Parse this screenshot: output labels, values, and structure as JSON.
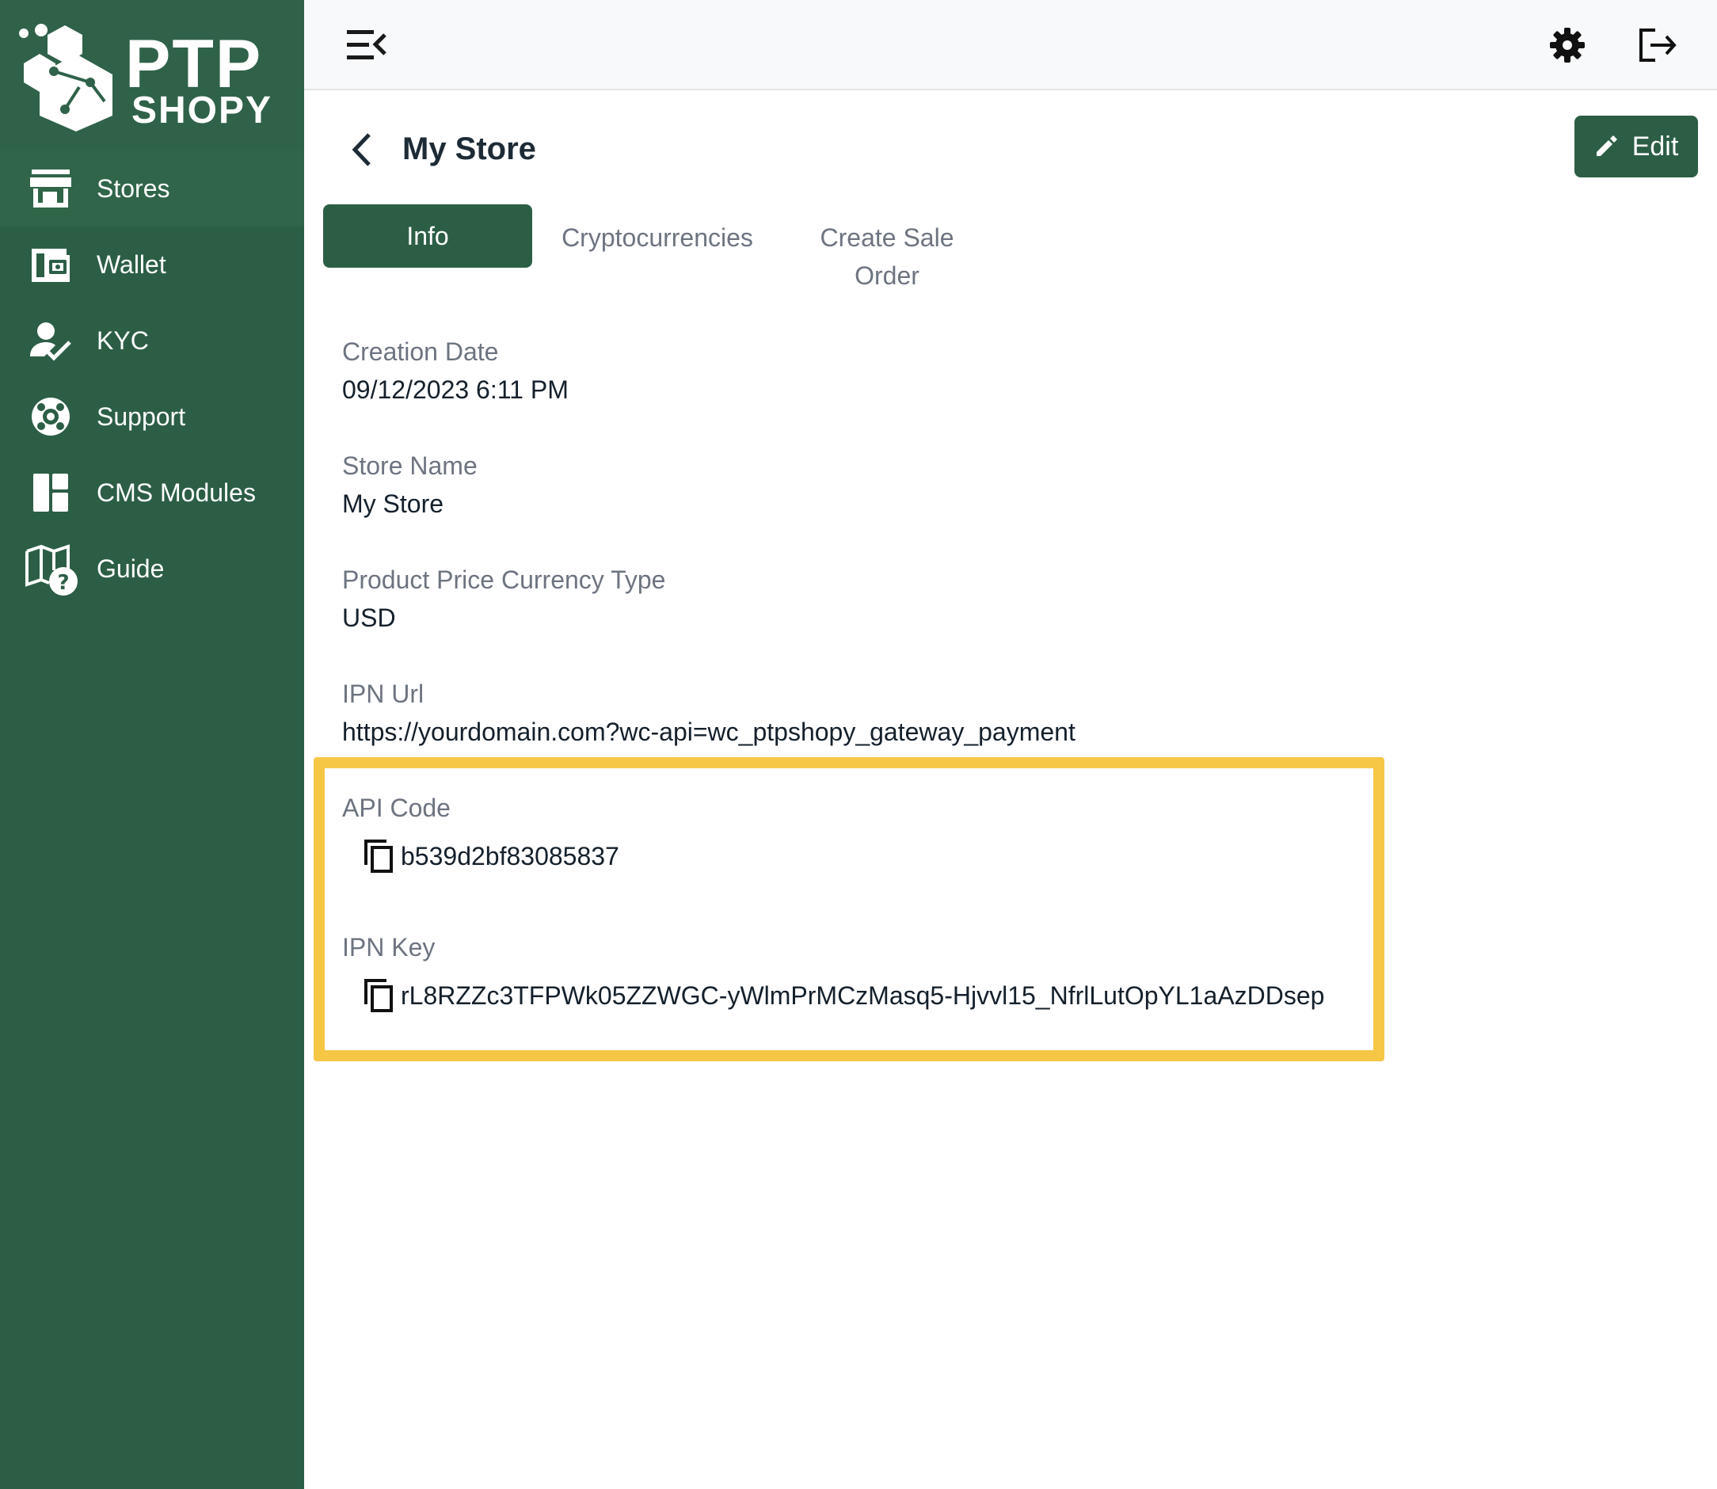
{
  "brand": {
    "line1": "PTP",
    "line2": "SHOPY"
  },
  "sidebar": {
    "items": [
      {
        "label": "Stores",
        "icon": "store-icon",
        "active": true
      },
      {
        "label": "Wallet",
        "icon": "wallet-icon"
      },
      {
        "label": "KYC",
        "icon": "user-check-icon"
      },
      {
        "label": "Support",
        "icon": "lifebuoy-icon"
      },
      {
        "label": "CMS Modules",
        "icon": "dashboard-icon"
      },
      {
        "label": "Guide",
        "icon": "book-question-icon"
      }
    ]
  },
  "topbar": {
    "menu_icon": "menu-collapse-icon",
    "settings_icon": "gear-icon",
    "logout_icon": "logout-icon"
  },
  "page": {
    "title": "My Store",
    "edit_label": "Edit"
  },
  "tabs": [
    {
      "label": "Info",
      "active": true
    },
    {
      "label": "Cryptocurrencies"
    },
    {
      "label": "Create Sale Order"
    }
  ],
  "fields": {
    "creation_date": {
      "label": "Creation Date",
      "value": "09/12/2023 6:11 PM"
    },
    "store_name": {
      "label": "Store Name",
      "value": "My Store"
    },
    "currency_type": {
      "label": "Product Price Currency Type",
      "value": "USD"
    },
    "ipn_url": {
      "label": "IPN Url",
      "value": "https://yourdomain.com?wc-api=wc_ptpshopy_gateway_payment"
    },
    "api_code": {
      "label": "API Code",
      "value": "b539d2bf83085837"
    },
    "ipn_key": {
      "label": "IPN Key",
      "value": "rL8RZZc3TFPWk05ZZWGC-yWlmPrMCzMasq5-Hjvvl15_NfrlLutOpYL1aAzDDsep"
    }
  },
  "colors": {
    "sidebar": "#2c5e46",
    "primary": "#2c5e46",
    "highlight": "#f5c745"
  }
}
